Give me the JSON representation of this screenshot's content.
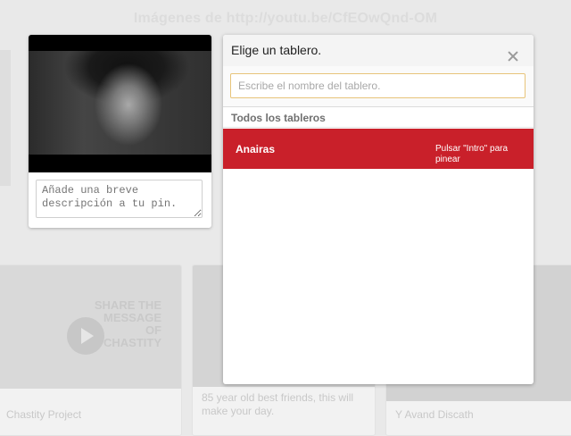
{
  "background": {
    "title": "Imágenes de http://youtu.be/CfEOwQnd-OM",
    "cards": [
      {
        "caption": "Chastity Project",
        "promo": "SHARE THE MESSAGE OF CHASTITY"
      },
      {
        "caption": "85 year old best friends, this will make your day."
      },
      {
        "caption": "Y Avand Discath"
      }
    ]
  },
  "pin": {
    "description_placeholder": "Añade una breve descripción a tu pin."
  },
  "picker": {
    "title": "Elige un tablero.",
    "search_placeholder": "Escribe el nombre del tablero.",
    "section_label": "Todos los tableros",
    "boards": [
      {
        "name": "Anairas",
        "hint": "Pulsar \"Intro\" para pinear"
      }
    ],
    "highlight_color": "#c9202a"
  },
  "icons": {
    "close": "close-icon",
    "play": "play-icon"
  }
}
